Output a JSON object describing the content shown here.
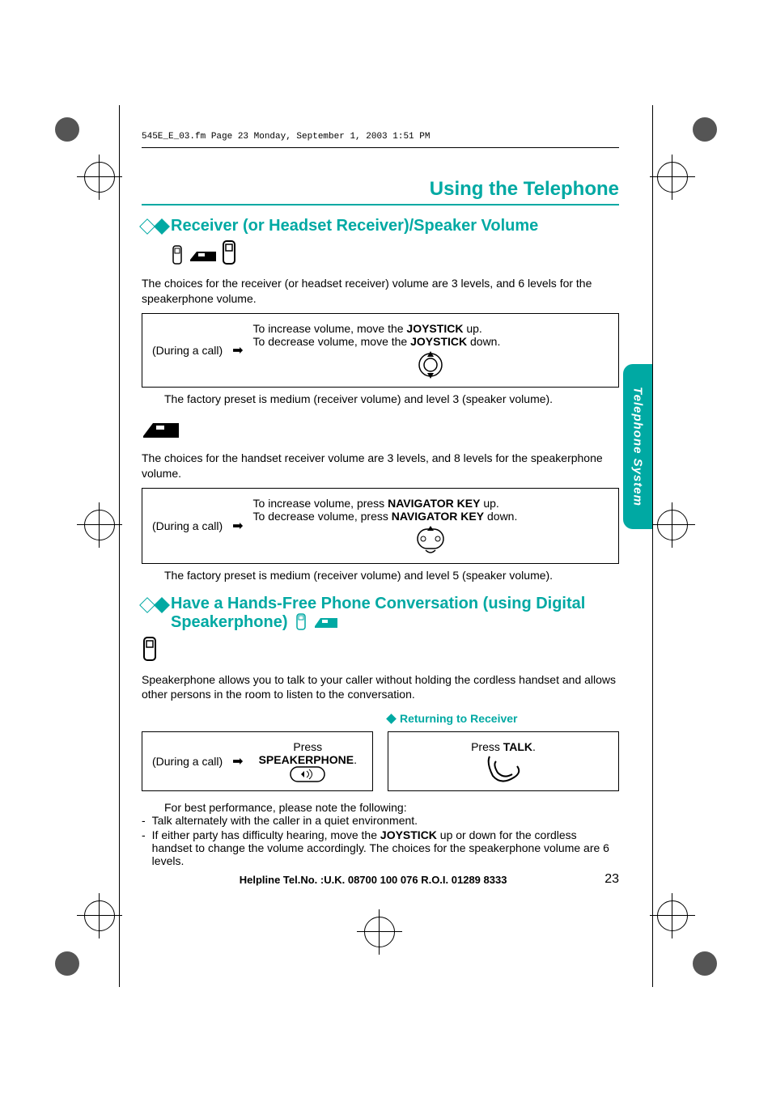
{
  "header_path": "545E_E_03.fm  Page 23  Monday, September 1, 2003  1:51 PM",
  "page_title": "Using the Telephone",
  "side_tab": "Telephone System",
  "section1": {
    "heading": "Receiver (or Headset Receiver)/Speaker Volume",
    "intro": "The choices for the receiver (or headset receiver) volume are 3 levels, and 6 levels for the speakerphone volume.",
    "during_call": "(During a call)",
    "inc_prefix": "To increase volume, move the ",
    "inc_bold": "JOYSTICK",
    "inc_suffix": " up.",
    "dec_prefix": "To decrease volume, move the ",
    "dec_bold": "JOYSTICK",
    "dec_suffix": " down.",
    "preset": "The factory preset is medium (receiver volume) and level 3 (speaker volume).",
    "intro2": "The choices for the handset receiver volume are 3 levels, and 8 levels for the speakerphone volume.",
    "inc2_prefix": "To increase volume, press ",
    "inc2_bold": "NAVIGATOR KEY",
    "inc2_suffix": " up.",
    "dec2_prefix": "To decrease volume, press ",
    "dec2_bold": "NAVIGATOR KEY",
    "dec2_suffix": " down.",
    "preset2": "The factory preset is medium (receiver volume) and level 5 (speaker volume)."
  },
  "section2": {
    "heading": "Have a Hands-Free Phone Conversation (using Digital Speakerphone)",
    "intro": "Speakerphone allows you to talk to your caller without holding the cordless handset and allows other persons in the room to listen to the conversation.",
    "box_left_press": "Press",
    "box_left_bold": "SPEAKERPHONE",
    "box_left_suffix": ".",
    "return_heading": "Returning to Receiver",
    "box_right_press": "Press ",
    "box_right_bold": "TALK",
    "box_right_suffix": ".",
    "note_lead": "For best performance, please note the following:",
    "note1": "Talk alternately with the caller in a quiet environment.",
    "note2_prefix": "If either party has difficulty hearing, move the ",
    "note2_bold": "JOYSTICK",
    "note2_suffix": " up or down for the cordless handset to change the volume accordingly. The choices for the speakerphone volume are 6 levels."
  },
  "footer": {
    "help": "Helpline Tel.No. :U.K. 08700 100 076  R.O.I. 01289 8333",
    "page_num": "23"
  }
}
